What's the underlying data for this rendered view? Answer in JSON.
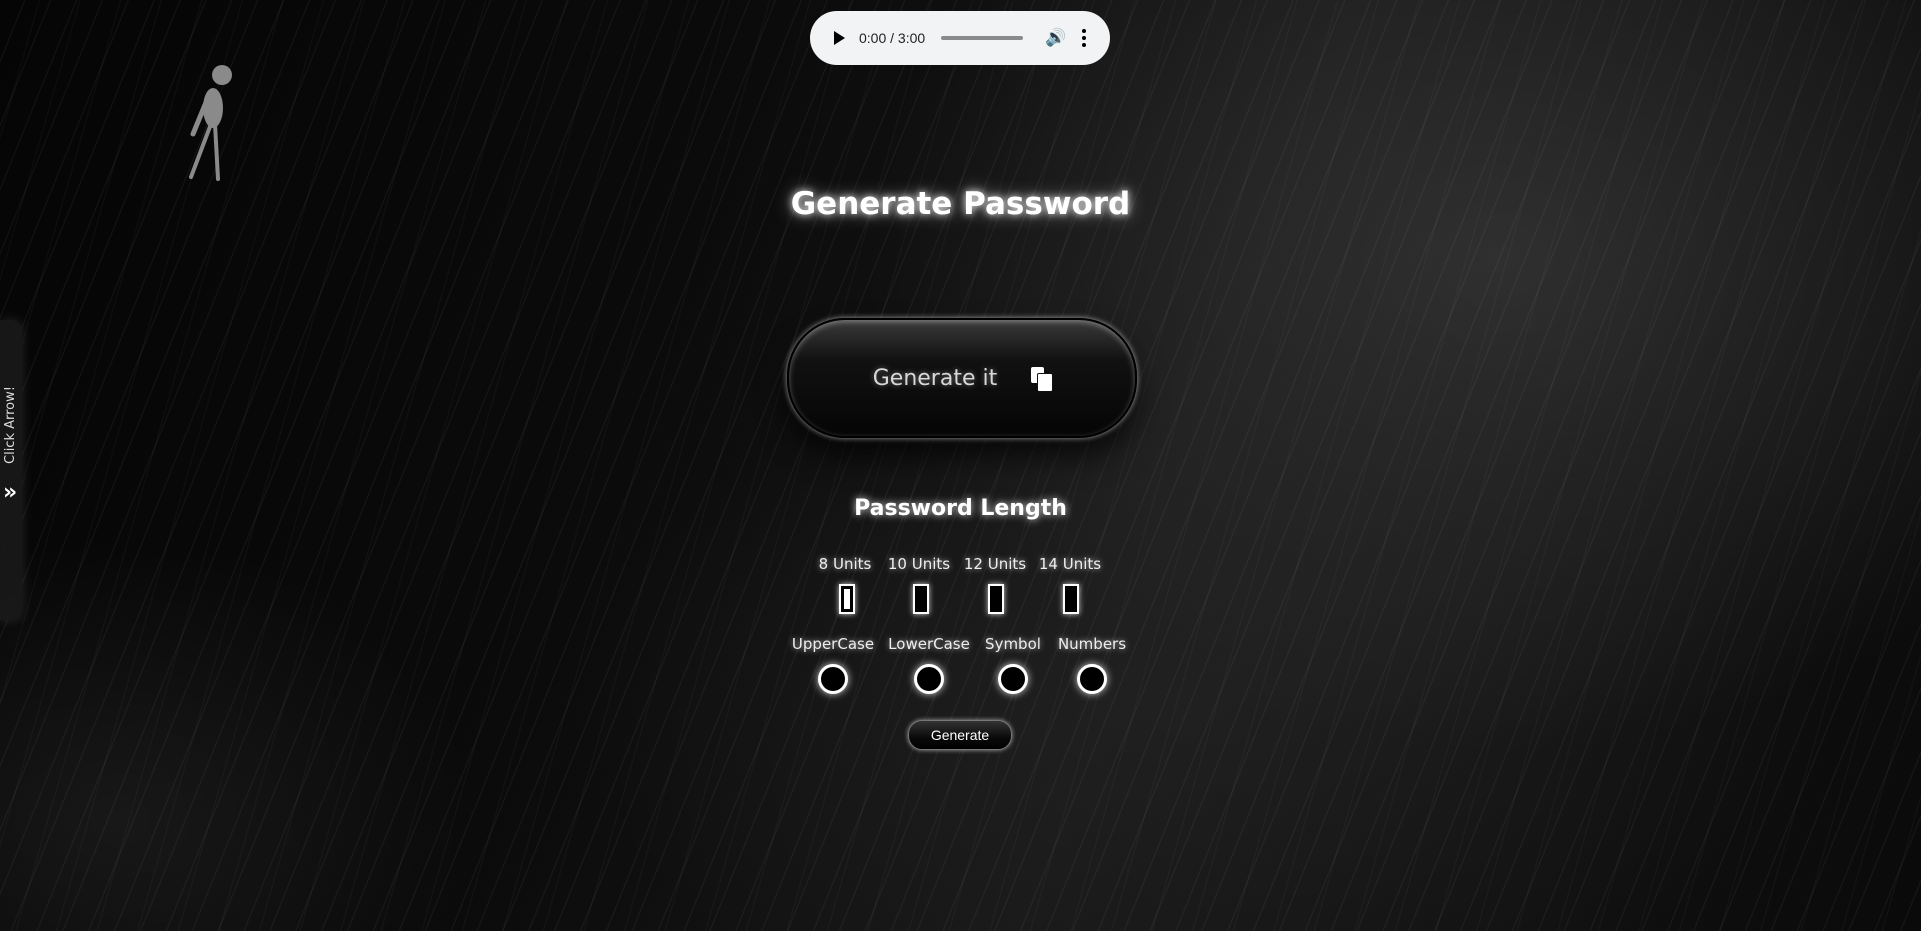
{
  "audio": {
    "time": "0:00 / 3:00"
  },
  "side_panel": {
    "label": "Click Arrow!",
    "arrow": "»"
  },
  "title": "Generate Password",
  "generator": {
    "label": "Generate it",
    "icon": "copy-icon"
  },
  "length": {
    "title": "Password Length",
    "options": [
      {
        "label": "8 Units",
        "checked": true
      },
      {
        "label": "10 Units",
        "checked": false
      },
      {
        "label": "12 Units",
        "checked": false
      },
      {
        "label": "14 Units",
        "checked": false
      }
    ]
  },
  "character_types": [
    {
      "label": "UpperCase"
    },
    {
      "label": "LowerCase"
    },
    {
      "label": "Symbol"
    },
    {
      "label": "Numbers"
    }
  ],
  "generate_button": "Generate"
}
